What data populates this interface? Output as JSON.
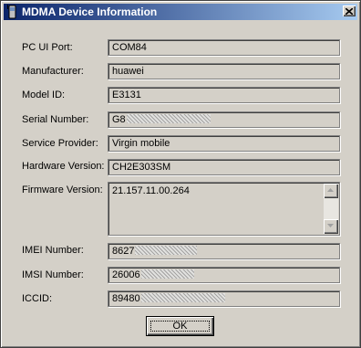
{
  "window": {
    "title": "MDMA Device Information",
    "app_icon": "phone-icon",
    "close_icon": "close-icon"
  },
  "fields": [
    {
      "label": "PC UI Port:",
      "value": "COM84"
    },
    {
      "label": "Manufacturer:",
      "value": "huawei"
    },
    {
      "label": "Model ID:",
      "value": "E3131"
    },
    {
      "label": "Serial Number:",
      "value": "G8"
    },
    {
      "label": "Service Provider:",
      "value": "Virgin mobile"
    },
    {
      "label": "Hardware Version:",
      "value": "CH2E303SM"
    },
    {
      "label": "Firmware Version:",
      "value": "21.157.11.00.264"
    },
    {
      "label": "IMEI Number:",
      "value": "8627"
    },
    {
      "label": "IMSI Number:",
      "value": "26006"
    },
    {
      "label": "ICCID:",
      "value": "89480"
    }
  ],
  "buttons": {
    "ok_label": "OK"
  }
}
